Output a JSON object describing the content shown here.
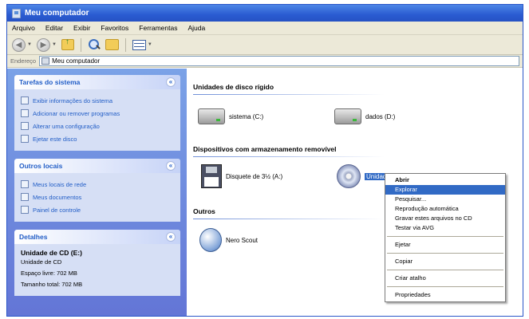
{
  "window": {
    "title": "Meu computador"
  },
  "menubar": [
    "Arquivo",
    "Editar",
    "Exibir",
    "Favoritos",
    "Ferramentas",
    "Ajuda"
  ],
  "address": {
    "label": "Endereço",
    "value": "Meu computador"
  },
  "sidebar": {
    "tasks": {
      "title": "Tarefas do sistema",
      "items": [
        "Exibir informações do sistema",
        "Adicionar ou remover programas",
        "Alterar uma configuração",
        "Ejetar este disco"
      ]
    },
    "places": {
      "title": "Outros locais",
      "items": [
        "Meus locais de rede",
        "Meus documentos",
        "Painel de controle"
      ]
    },
    "details": {
      "title": "Detalhes",
      "name": "Unidade de CD (E:)",
      "type": "Unidade de CD",
      "free": "Espaço livre: 702 MB",
      "total": "Tamanho total: 702 MB"
    }
  },
  "content": {
    "hard_disks": {
      "title": "Unidades de disco rígido",
      "items": [
        "sistema (C:)",
        "dados (D:)"
      ]
    },
    "removable": {
      "title": "Dispositivos com armazenamento removível",
      "items": [
        "Disquete de 3½ (A:)",
        "Unidade de CD (E:)"
      ]
    },
    "others": {
      "title": "Outros",
      "items": [
        "Nero Scout"
      ]
    }
  },
  "context_menu": {
    "items": [
      "Abrir",
      "Explorar",
      "Pesquisar...",
      "Reprodução automática",
      "Gravar estes arquivos no CD",
      "Testar via AVG",
      "Ejetar",
      "Copiar",
      "Criar atalho",
      "Propriedades"
    ],
    "highlighted": "Explorar"
  },
  "colors": {
    "titlebar": "#2a5bd1",
    "sidebar": "#6f8fde",
    "panel_title": "#215dc6",
    "selection": "#316ac5"
  }
}
